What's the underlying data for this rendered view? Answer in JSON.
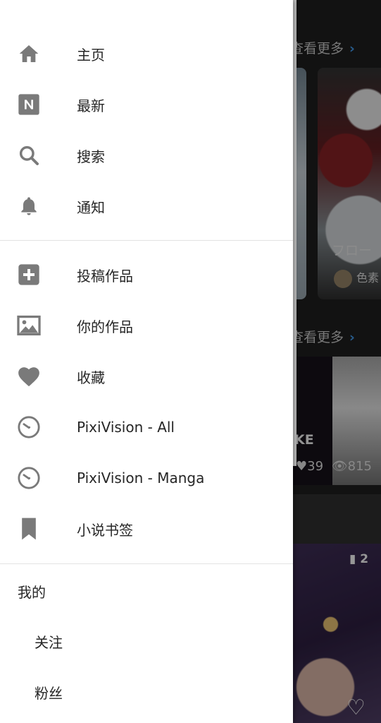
{
  "background": {
    "see_more_1": "查看更多",
    "see_more_2": "查看更多",
    "see_more_chevron": "›",
    "card_b_title": "フロー",
    "card_b_author": "色素",
    "card_c_title": "KE",
    "card_c_likes": "39",
    "card_c_views": "815",
    "card_d_pages": "2"
  },
  "drawer": {
    "nav": [
      {
        "label": "主页",
        "icon": "home-icon"
      },
      {
        "label": "最新",
        "icon": "new-badge-icon"
      },
      {
        "label": "搜索",
        "icon": "search-icon"
      },
      {
        "label": "通知",
        "icon": "bell-icon"
      }
    ],
    "works": [
      {
        "label": "投稿作品",
        "icon": "plus-box-icon"
      },
      {
        "label": "你的作品",
        "icon": "image-icon"
      },
      {
        "label": "收藏",
        "icon": "heart-icon"
      },
      {
        "label": "PixiVision - All",
        "icon": "clock-icon"
      },
      {
        "label": "PixiVision - Manga",
        "icon": "clock-icon"
      },
      {
        "label": "小说书签",
        "icon": "bookmark-icon"
      }
    ],
    "mine": {
      "title": "我的",
      "items": [
        {
          "label": "关注"
        },
        {
          "label": "粉丝"
        }
      ]
    }
  },
  "colors": {
    "icon": "#7a7a7a",
    "text": "#262626",
    "accent": "#3d8dd6"
  }
}
